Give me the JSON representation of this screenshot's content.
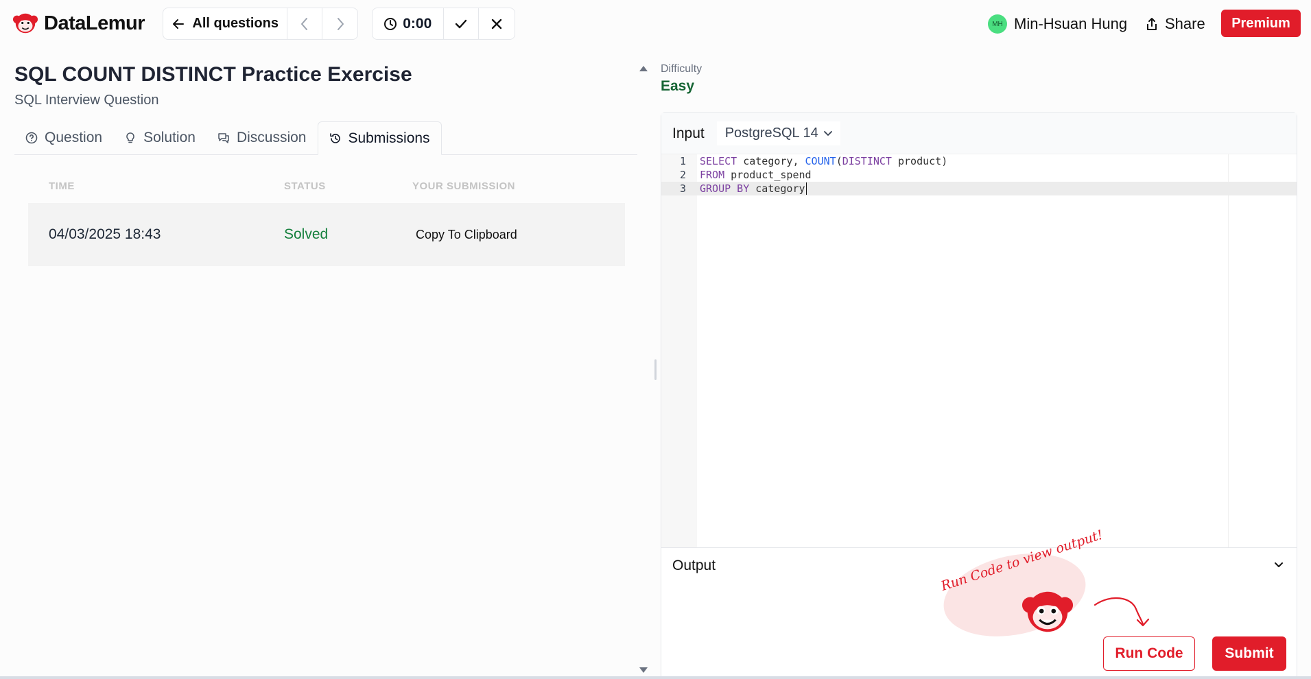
{
  "brand": {
    "name": "DataLemur",
    "accent": "#e11d2a"
  },
  "nav": {
    "all_questions_label": "All questions",
    "timer": "0:00"
  },
  "user": {
    "initials": "MH",
    "name": "Min-Hsuan Hung",
    "share_label": "Share",
    "premium_label": "Premium"
  },
  "question": {
    "title": "SQL COUNT DISTINCT Practice Exercise",
    "subtitle": "SQL Interview Question",
    "difficulty_label": "Difficulty",
    "difficulty": "Easy"
  },
  "tabs": [
    {
      "label": "Question",
      "icon": "question-circle-icon"
    },
    {
      "label": "Solution",
      "icon": "lightbulb-icon"
    },
    {
      "label": "Discussion",
      "icon": "chat-bubbles-icon"
    },
    {
      "label": "Submissions",
      "icon": "history-icon",
      "active": true
    }
  ],
  "submissions": {
    "headers": [
      "TIME",
      "STATUS",
      "YOUR SUBMISSION"
    ],
    "rows": [
      {
        "time": "04/03/2025 18:43",
        "status": "Solved",
        "action": "Copy To Clipboard"
      }
    ]
  },
  "editor": {
    "input_label": "Input",
    "language": "PostgreSQL 14",
    "lines": [
      {
        "n": "1",
        "kw1": "SELECT",
        "t1": " category, ",
        "fn": "COUNT",
        "t2": "(",
        "kw2": "DISTINCT",
        "t3": " product)"
      },
      {
        "n": "2",
        "kw1": "FROM",
        "t1": " product_spend"
      },
      {
        "n": "3",
        "kw1": "GROUP BY",
        "t1": " category"
      }
    ]
  },
  "output": {
    "label": "Output",
    "hint": "Run Code to view output!",
    "run_label": "Run Code",
    "submit_label": "Submit"
  }
}
